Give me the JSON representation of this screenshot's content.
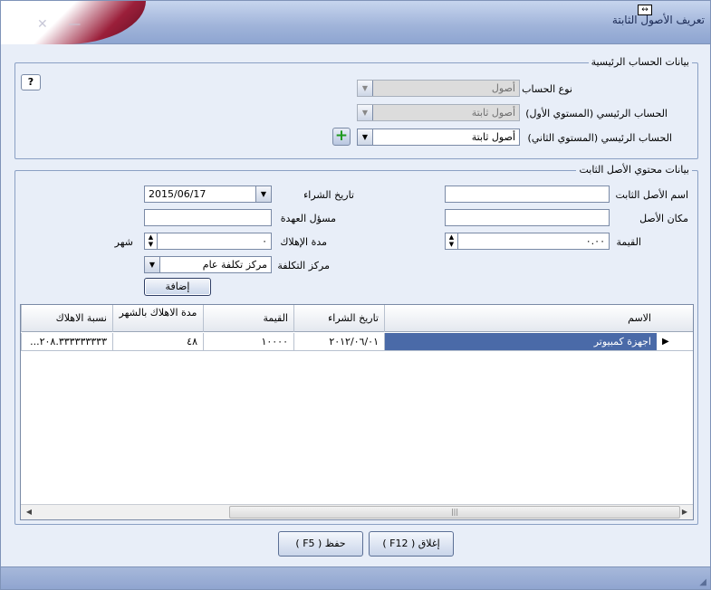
{
  "window": {
    "title": "تعريف الأصول الثابتة"
  },
  "help": {
    "label": "?"
  },
  "main_account": {
    "legend": "بيانات الحساب الرئيسية",
    "account_type_label": "نوع الحساب",
    "account_type_value": "أصول",
    "main_level1_label": "الحساب الرئيسي (المستوي الأول)",
    "main_level1_value": "أصول ثابتة",
    "main_level2_label": "الحساب الرئيسي (المستوي الثاني)",
    "main_level2_value": "أصول ثابتة",
    "add_glyph": "+"
  },
  "asset": {
    "legend": "بيانات محتوي الأصل الثابت",
    "name_label": "اسم الأصل الثابت",
    "name_value": "",
    "location_label": "مكان الأصل",
    "location_value": "",
    "value_label": "القيمة",
    "value_value": "٠.٠٠",
    "purchase_date_label": "تاريخ الشراء",
    "purchase_date_value": "2015/06/17",
    "custodian_label": "مسؤل العهدة",
    "custodian_value": "",
    "depreciation_label": "مدة الإهلاك",
    "depreciation_value": "٠",
    "depreciation_unit": "شهر",
    "cost_center_label": "مركز التكلفة",
    "cost_center_value": "مركز تكلفة عام",
    "add_button": "إضافة"
  },
  "grid": {
    "columns": [
      "الاسم",
      "تاريخ الشراء",
      "القيمة",
      "مدة الاهلاك بالشهر",
      "نسبة الاهلاك"
    ],
    "rows": [
      {
        "name": "اجهزة كمبيوتر",
        "purchase_date": "٢٠١٢/٠٦/٠١",
        "value": "١٠٠٠٠",
        "depreciation_months": "٤٨",
        "depreciation_rate": "٢٠٨.٣٣٣٣٣٣٣٣٣..."
      }
    ],
    "row_marker": "▶"
  },
  "footer": {
    "close_button": "إغلاق ( F12 )",
    "save_button": "حفظ ( F5 )"
  }
}
